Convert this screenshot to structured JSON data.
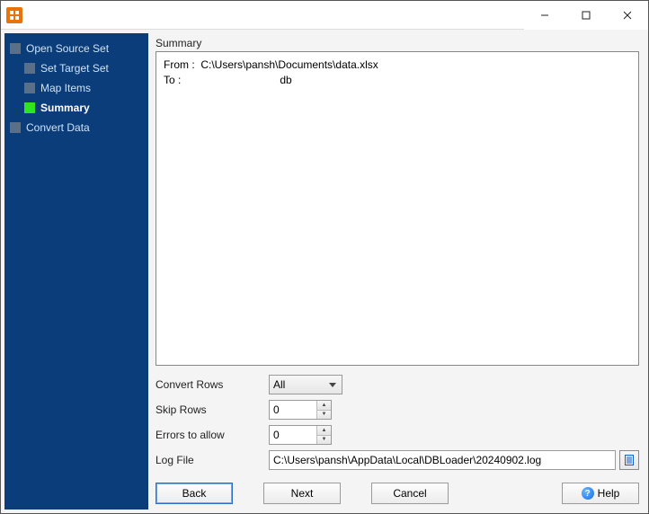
{
  "titlebar": {
    "title": ""
  },
  "nav": {
    "items": [
      {
        "label": "Open Source Set",
        "indent": false,
        "active": false
      },
      {
        "label": "Set Target Set",
        "indent": true,
        "active": false
      },
      {
        "label": "Map Items",
        "indent": true,
        "active": false
      },
      {
        "label": "Summary",
        "indent": true,
        "active": true
      },
      {
        "label": "Convert Data",
        "indent": false,
        "active": false
      }
    ]
  },
  "panel": {
    "group_label": "Summary",
    "summary_from_label": "From :",
    "summary_from_value": "C:\\Users\\pansh\\Documents\\data.xlsx",
    "summary_to_label": "To :",
    "summary_to_value": "db",
    "convert_rows_label": "Convert Rows",
    "convert_rows_value": "All",
    "skip_rows_label": "Skip Rows",
    "skip_rows_value": "0",
    "errors_label": "Errors to allow",
    "errors_value": "0",
    "logfile_label": "Log File",
    "logfile_value": "C:\\Users\\pansh\\AppData\\Local\\DBLoader\\20240902.log"
  },
  "buttons": {
    "back": "Back",
    "next": "Next",
    "cancel": "Cancel",
    "help": "Help"
  }
}
